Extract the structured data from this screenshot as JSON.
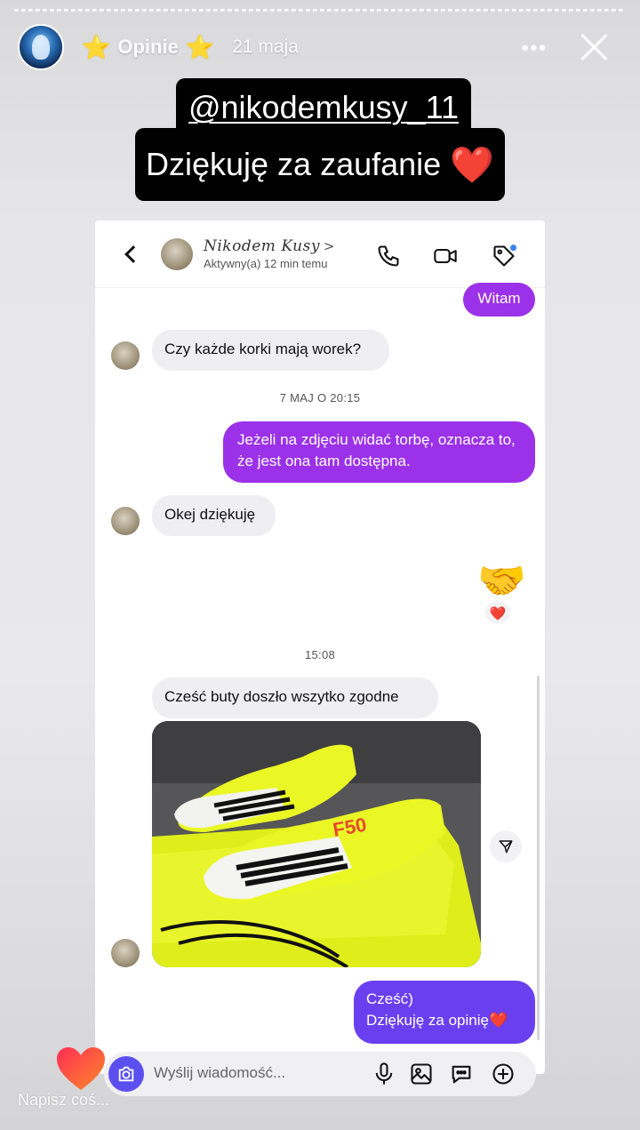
{
  "story": {
    "title": "Opinie",
    "star_left": "⭐",
    "star_right": "⭐",
    "time": "21 maja",
    "more": "•••",
    "reply_placeholder": "Napisz coś..."
  },
  "caption": {
    "handle": "@nikodemkusy_11",
    "thanks": "Dziękuję za zaufanie",
    "heart": "❤️"
  },
  "chat": {
    "contact_name": "Nikodem Kusy",
    "contact_chevron": ">",
    "contact_status": "Aktywny(a) 12 min temu",
    "messages": [
      {
        "dir": "out",
        "text": "Witam"
      },
      {
        "dir": "in",
        "text": "Czy każde korki mają worek?"
      },
      {
        "type": "timestamp",
        "text": "7 MAJ O 20:15"
      },
      {
        "dir": "out",
        "text": "Jeżeli na zdjęciu widać torbę, oznacza to, że jest ona tam dostępna."
      },
      {
        "dir": "in",
        "text": "Okej dziękuję"
      },
      {
        "dir": "out",
        "emoji": "🤝",
        "reaction": "❤️"
      },
      {
        "type": "timestamp",
        "text": "15:08"
      },
      {
        "dir": "in",
        "text": "Cześć buty doszło wszytko zgodne"
      },
      {
        "dir": "in",
        "type": "photo",
        "photo_text": "F50"
      },
      {
        "dir": "out",
        "text_line1": "Cześć)",
        "text_line2": "Dziękuję za opinię",
        "heart": "❤️"
      }
    ],
    "composer_placeholder": "Wyślij wiadomość..."
  },
  "colors": {
    "outgoing": "#9b31e8",
    "outgoing_last": "#6a3ff0",
    "incoming": "#efeff1",
    "camera": "#5b4ff0",
    "notification_dot": "#3b82f6"
  }
}
